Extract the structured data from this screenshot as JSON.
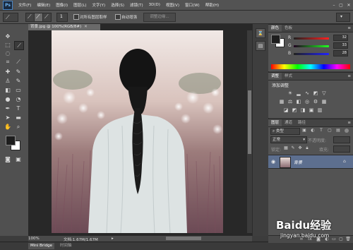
{
  "app": {
    "logo": "Ps"
  },
  "menu": {
    "items": [
      "文件(F)",
      "编辑(E)",
      "图像(I)",
      "图层(L)",
      "文字(Y)",
      "选择(S)",
      "滤镜(T)",
      "3D(D)",
      "视图(V)",
      "窗口(W)",
      "帮助(H)"
    ]
  },
  "options": {
    "brush_size": "1",
    "sample_all_layers": "对所有图层取样",
    "auto_enhance": "自动增强",
    "refine_edge": "调整边缘..."
  },
  "document": {
    "tab_title": "背景.jpg @ 100%(RGB/8#)",
    "zoom": "100%",
    "doc_info": "文档:1.67M/1.67M"
  },
  "bottom": {
    "mini_bridge": "Mini Bridge",
    "timeline": "时间轴"
  },
  "color_panel": {
    "tabs": [
      "颜色",
      "色板"
    ],
    "channels": [
      {
        "label": "R",
        "value": "32"
      },
      {
        "label": "G",
        "value": "33"
      },
      {
        "label": "B",
        "value": "28"
      }
    ]
  },
  "adjustments_panel": {
    "tabs": [
      "调整",
      "样式"
    ],
    "heading": "添加调整"
  },
  "layers_panel": {
    "tabs": [
      "图层",
      "通道",
      "路径"
    ],
    "kind_filter": "类型",
    "blend_mode": "正常",
    "opacity_label": "不透明度:",
    "lock_label": "锁定:",
    "fill_label": "填充:",
    "layers": [
      {
        "name": "背景"
      }
    ]
  },
  "colors": {
    "ui_dark": "#535353",
    "selected_layer": "#5d6f8f",
    "foreground": "#1e1e1e",
    "background": "#ffffff"
  },
  "watermark": {
    "text": "Baidu经验",
    "subtext": "jingyan.baidu.com"
  }
}
